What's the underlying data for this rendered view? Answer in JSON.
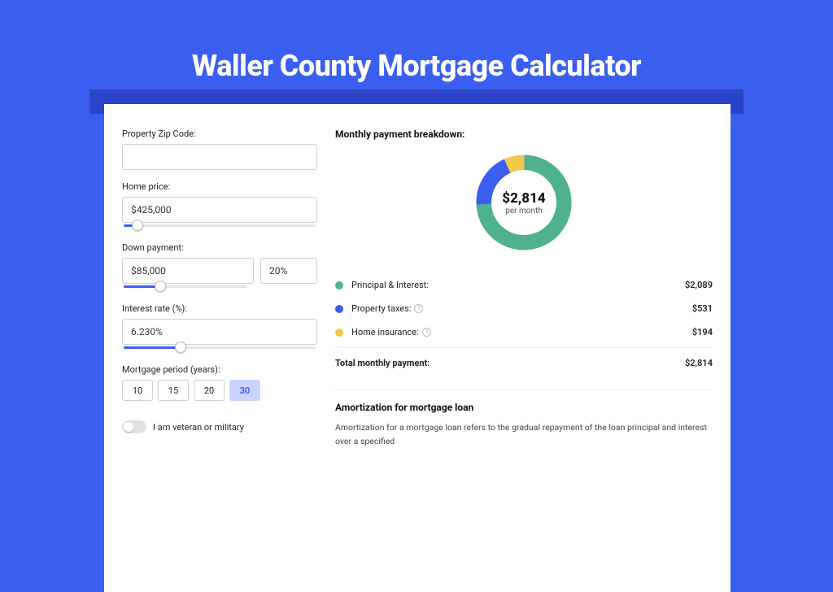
{
  "page": {
    "title": "Waller County Mortgage Calculator"
  },
  "form": {
    "zip": {
      "label": "Property Zip Code:",
      "value": ""
    },
    "price": {
      "label": "Home price:",
      "value": "$425,000",
      "slider_pct": 8
    },
    "down": {
      "label": "Down payment:",
      "value": "$85,000",
      "pct": "20%",
      "slider_pct": 20
    },
    "rate": {
      "label": "Interest rate (%):",
      "value": "6.230%",
      "slider_pct": 30
    },
    "period": {
      "label": "Mortgage period (years):",
      "options": [
        "10",
        "15",
        "20",
        "30"
      ],
      "active": "30"
    },
    "veteran_label": "I am veteran or military"
  },
  "breakdown": {
    "title": "Monthly payment breakdown:",
    "total_value": "$2,814",
    "total_sub": "per month",
    "rows": [
      {
        "label": "Principal & Interest:",
        "amount": "$2,089",
        "color": "#4fb28b",
        "info": false
      },
      {
        "label": "Property taxes:",
        "amount": "$531",
        "color": "#3a5ff0",
        "info": true
      },
      {
        "label": "Home insurance:",
        "amount": "$194",
        "color": "#f0c94a",
        "info": true
      }
    ],
    "total_row": {
      "label": "Total monthly payment:",
      "amount": "$2,814"
    }
  },
  "amort": {
    "title": "Amortization for mortgage loan",
    "text": "Amortization for a mortgage loan refers to the gradual repayment of the loan principal and interest over a specified"
  },
  "chart_data": {
    "type": "pie",
    "title": "Monthly payment breakdown",
    "series": [
      {
        "name": "Principal & Interest",
        "value": 2089,
        "color": "#4fb28b"
      },
      {
        "name": "Property taxes",
        "value": 531,
        "color": "#3a5ff0"
      },
      {
        "name": "Home insurance",
        "value": 194,
        "color": "#f0c94a"
      }
    ],
    "total": 2814,
    "center_label": "$2,814 per month"
  }
}
